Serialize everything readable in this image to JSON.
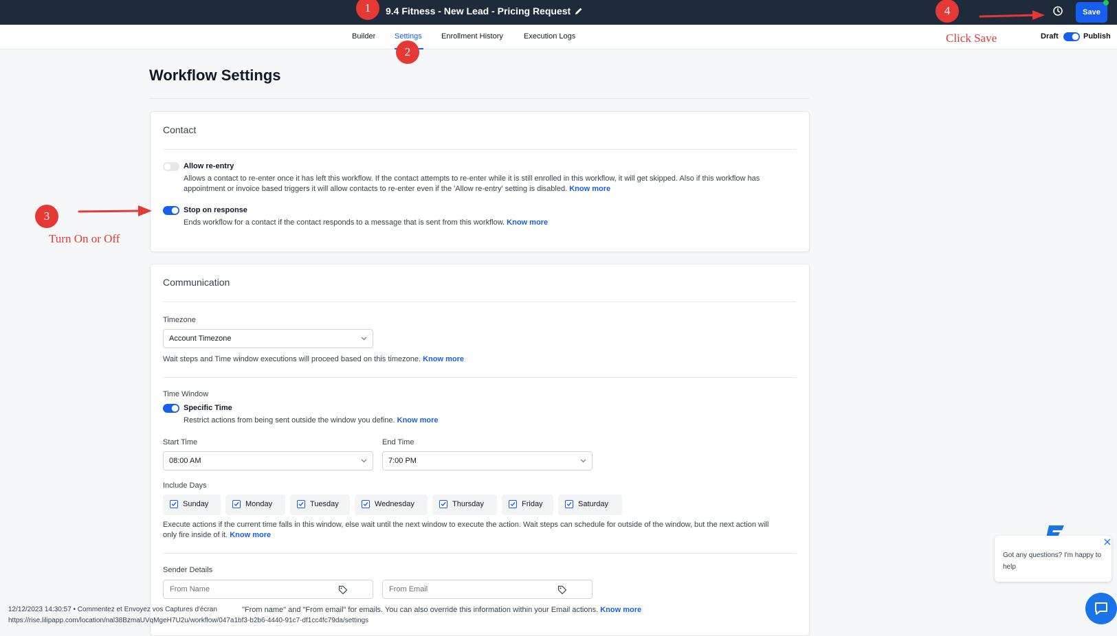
{
  "header": {
    "workflow_title": "9.4 Fitness - New Lead - Pricing Request",
    "save_label": "Save"
  },
  "tabs": [
    {
      "label": "Builder"
    },
    {
      "label": "Settings",
      "active": true
    },
    {
      "label": "Enrollment History"
    },
    {
      "label": "Execution Logs"
    }
  ],
  "publish_toggle": {
    "draft_label": "Draft",
    "publish_label": "Publish",
    "published": true
  },
  "page": {
    "title": "Workflow Settings"
  },
  "contact": {
    "title": "Contact",
    "allow_reentry": {
      "label": "Allow re-entry",
      "enabled": false,
      "desc_line1": "Allows a contact to re-enter once it has left this workflow. If the contact attempts to re-enter while it is still enrolled in this workflow, it will get skipped. Also if this workflow has",
      "desc_line2": "appointment or invoice based triggers it will allow contacts to re-enter even if the 'Allow re-entry' setting is disabled.",
      "link": "Know more"
    },
    "stop_on_response": {
      "label": "Stop on response",
      "enabled": true,
      "desc": "Ends workflow for a contact if the contact responds to a message that is sent from this workflow.",
      "link": "Know more"
    }
  },
  "communication": {
    "title": "Communication",
    "timezone_label": "Timezone",
    "timezone_value": "Account Timezone",
    "timezone_help": "Wait steps and Time window executions will proceed based on this timezone.",
    "timezone_link": "Know more",
    "time_window_label": "Time Window",
    "specific_time_label": "Specific Time",
    "specific_time_enabled": true,
    "specific_time_help": "Restrict actions from being sent outside the window you define.",
    "specific_time_link": "Know more",
    "start_time_label": "Start Time",
    "start_time_value": "08:00 AM",
    "end_time_label": "End Time",
    "end_time_value": "7:00 PM",
    "include_days_label": "Include Days",
    "days": [
      {
        "label": "Sunday",
        "checked": true
      },
      {
        "label": "Monday",
        "checked": true
      },
      {
        "label": "Tuesday",
        "checked": true
      },
      {
        "label": "Wednesday",
        "checked": true
      },
      {
        "label": "Thursday",
        "checked": true
      },
      {
        "label": "Friday",
        "checked": true
      },
      {
        "label": "Saturday",
        "checked": true
      }
    ],
    "window_help_line1": "Execute actions if the current time falls in this window, else wait until the next window to execute the action. Wait steps can schedule for outside of the window, but the next action will",
    "window_help_line2": "only fire inside of it.",
    "window_link": "Know more",
    "sender_details_label": "Sender Details",
    "from_name_placeholder": "From Name",
    "from_email_placeholder": "From Email",
    "sender_help": "\"From name\" and \"From email\" for emails. You can also override this information within your Email actions.",
    "sender_link": "Know more"
  },
  "annotations": {
    "step1": "1",
    "step2": "2",
    "step3": "3",
    "step4": "4",
    "click_save": "Click Save",
    "turn_on_off": "Turn On or Off"
  },
  "chat": {
    "message": "Got any questions? I'm happy to help"
  },
  "footer": {
    "capture_line": "12/12/2023 14:30:57 • Commentez et Envoyez vos Captures d'écran",
    "url_line": "https://rise.lilipapp.com/location/nal38BzmaUVqMgeH7U2u/workflow/047a1bf3-b2b6-4440-91c7-df1cc4fc79da/settings"
  },
  "colors": {
    "accent": "#155eef",
    "header_bg": "#1f2a3c",
    "annotation": "#e53935"
  }
}
